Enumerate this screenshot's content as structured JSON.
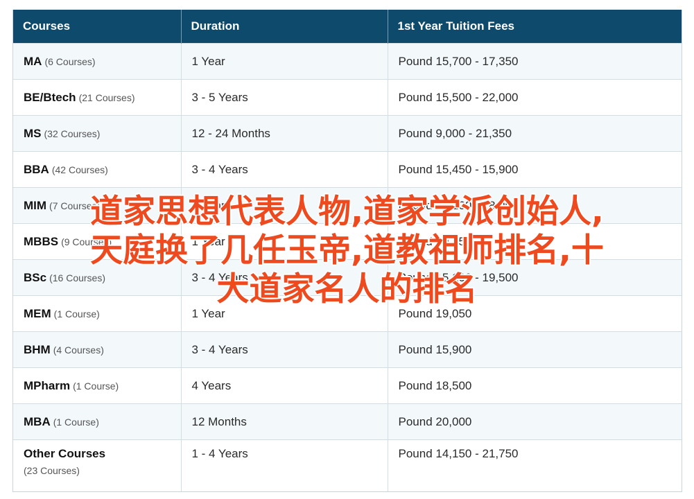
{
  "table": {
    "headers": [
      "Courses",
      "Duration",
      "1st Year Tuition Fees"
    ],
    "rows": [
      {
        "course": "MA",
        "count": "(6 Courses)",
        "duration": "1 Year",
        "fees": "Pound 15,700 - 17,350"
      },
      {
        "course": "BE/Btech",
        "count": "(21 Courses)",
        "duration": "3 - 5 Years",
        "fees": "Pound 15,500 - 22,000"
      },
      {
        "course": "MS",
        "count": "(32 Courses)",
        "duration": "12 - 24 Months",
        "fees": "Pound 9,000 - 21,350"
      },
      {
        "course": "BBA",
        "count": "(42 Courses)",
        "duration": "3 - 4 Years",
        "fees": "Pound 15,450 - 15,900"
      },
      {
        "course": "MIM",
        "count": "(7 Courses)",
        "duration": "1 Year",
        "fees": "Pound 15,100 - 18,900"
      },
      {
        "course": "MBBS",
        "count": "(9 Courses)",
        "duration": "1 Year",
        "fees": "Pound 30,750"
      },
      {
        "course": "BSc",
        "count": "(16 Courses)",
        "duration": "3 - 4 Years",
        "fees": "Pound 15,100 - 19,500"
      },
      {
        "course": "MEM",
        "count": "(1 Course)",
        "duration": "1 Year",
        "fees": "Pound 19,050"
      },
      {
        "course": "BHM",
        "count": "(4 Courses)",
        "duration": "3 - 4 Years",
        "fees": "Pound 15,900"
      },
      {
        "course": "MPharm",
        "count": "(1 Course)",
        "duration": "4 Years",
        "fees": "Pound 18,500"
      },
      {
        "course": "MBA",
        "count": "(1 Course)",
        "duration": "12 Months",
        "fees": "Pound 20,000"
      },
      {
        "course": "Other Courses",
        "count": "(23 Courses)",
        "duration": "1 - 4 Years",
        "fees": "Pound 14,150 - 21,750"
      }
    ]
  },
  "overlay": {
    "lines": [
      "道家思想代表人物,道家学派创始人,",
      "天庭换了几任玉帝,道教祖师排名,十",
      "大道家名人的排名"
    ]
  },
  "colors": {
    "header_bg": "#0d4a6b",
    "stripe_bg": "#f3f8fb",
    "overlay_text": "#ee4a1f"
  }
}
